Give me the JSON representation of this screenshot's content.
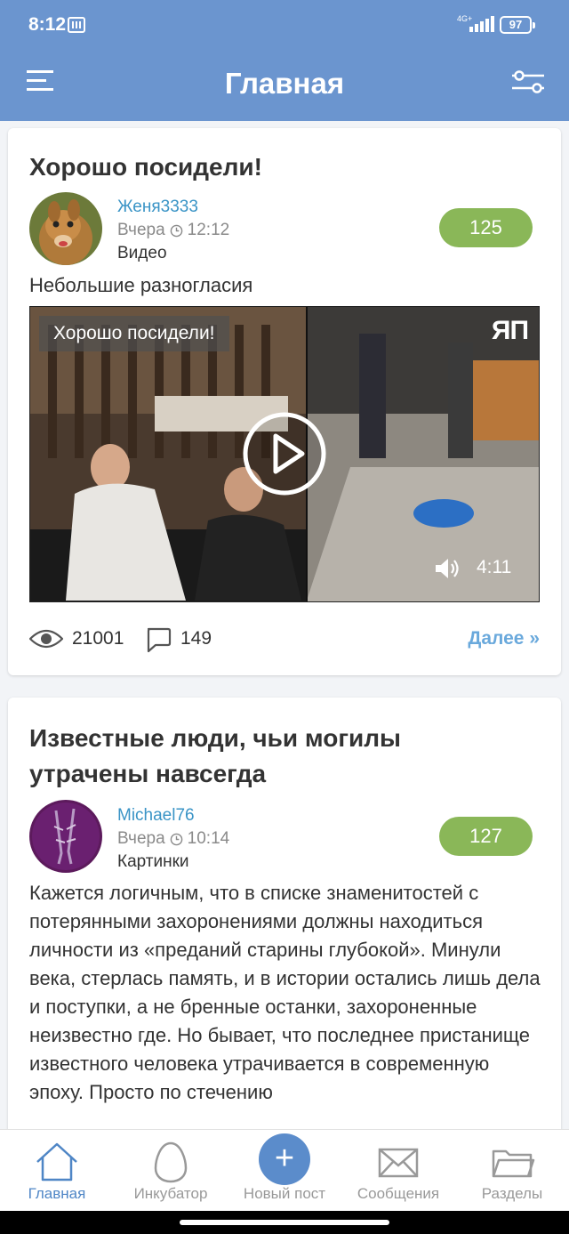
{
  "status_bar": {
    "time": "8:12",
    "network": "4G+",
    "battery": "97"
  },
  "header": {
    "title": "Главная"
  },
  "posts": [
    {
      "title": "Хорошо посидели!",
      "author": "Женя3333",
      "day": "Вчера",
      "time": "12:12",
      "type": "Видео",
      "rating": "125",
      "subtitle": "Небольшие разногласия",
      "video": {
        "caption": "Хорошо посидели!",
        "logo": "ЯП",
        "duration": "4:11"
      },
      "views": "21001",
      "comments": "149",
      "more": "Далее »"
    },
    {
      "title_line1": "Известные люди, чьи могилы",
      "title_line2": "утрачены навсегда",
      "author": "Michael76",
      "day": "Вчера",
      "time": "10:14",
      "type": "Картинки",
      "rating": "127",
      "text": "Кажется логичным, что в списке знаменитостей с потерянными захоронениями должны находиться личности из «преданий старины глубокой». Минули века, стерлась память, и в истории остались лишь дела и поступки, а не бренные останки, захороненные неизвестно где. Но бывает, что последнее пристанище известного человека утрачивается в современную эпоху. Просто по стечению"
    }
  ],
  "bottom_nav": [
    {
      "label": "Главная",
      "icon": "home-icon",
      "active": true
    },
    {
      "label": "Инкубатор",
      "icon": "egg-icon",
      "active": false
    },
    {
      "label": "Новый пост",
      "icon": "plus-icon",
      "active": false
    },
    {
      "label": "Сообщения",
      "icon": "envelope-icon",
      "active": false
    },
    {
      "label": "Разделы",
      "icon": "folder-icon",
      "active": false
    }
  ],
  "colors": {
    "header": "#6b95cf",
    "rating": "#8ab758",
    "author": "#3a94c6",
    "link": "#6aa9dc",
    "nav_active": "#4f86c6"
  }
}
